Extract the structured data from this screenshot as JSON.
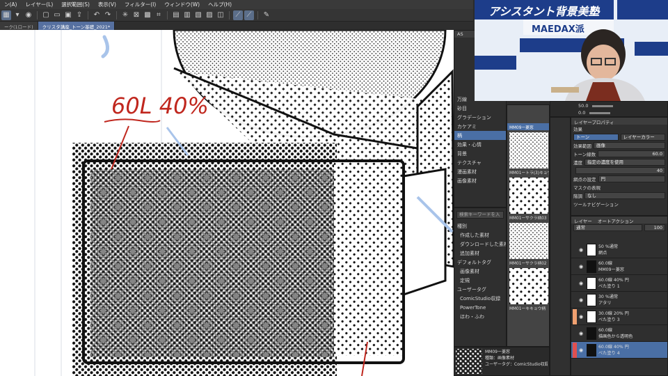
{
  "menu": [
    {
      "label": "ン(A)"
    },
    {
      "label": "レイヤー(L)"
    },
    {
      "label": "選択範囲(S)"
    },
    {
      "label": "表示(V)"
    },
    {
      "label": "フィルター(I)"
    },
    {
      "label": "ウィンドウ(W)"
    },
    {
      "label": "ヘルプ(H)"
    }
  ],
  "tabs": [
    {
      "label": "ーク(1ロード)"
    },
    {
      "label": "クリスタ講座_トーン基礎_2021*"
    }
  ],
  "canvas": {
    "annotation": "60L 40%"
  },
  "material_tree": {
    "header": "AS",
    "items": [
      {
        "label": "万線"
      },
      {
        "label": "砂目"
      },
      {
        "label": "グラデーション"
      },
      {
        "label": "カケアミ"
      },
      {
        "label": "柄"
      },
      {
        "label": "効果・心情"
      },
      {
        "label": "背景"
      },
      {
        "label": "テクスチャ"
      },
      {
        "label": "漫画素材"
      },
      {
        "label": "画像素材"
      }
    ],
    "selected_index": 4
  },
  "material_search": {
    "placeholder": "検索キーワードを入",
    "type_label": "種別",
    "types": [
      {
        "label": "作成した素材"
      },
      {
        "label": "ダウンロードした素材"
      },
      {
        "label": "追加素材"
      }
    ],
    "default_tag_label": "デフォルトタグ",
    "default_tags": [
      {
        "label": "画像素材"
      },
      {
        "label": "定規"
      }
    ],
    "user_tag_label": "ユーザータグ",
    "user_tags": [
      {
        "label": "ComicStudio収録"
      },
      {
        "label": "PowerTone"
      },
      {
        "label": "ほわ・ふわ"
      }
    ]
  },
  "material_thumbs": [
    {
      "label": "MM09ー菱窓"
    },
    {
      "label": "MM01ートラ(3)キョウ柄"
    },
    {
      "label": "MM01ーサクラ柄03"
    },
    {
      "label": "MM01ーサクラ柄02"
    },
    {
      "label": "MM01ーキキョウ柄"
    }
  ],
  "material_detail": {
    "name": "MM09ー菱窓",
    "type": "種類：画像素材",
    "tag": "ユーザータグ：ComicStudio収録"
  },
  "navigator": {
    "zoom": "50.0",
    "rotate": "0.0"
  },
  "tool_property": {
    "title": "レイヤープロパティ",
    "effect_label": "効果",
    "tabs": [
      {
        "label": "トーン"
      },
      {
        "label": "レイヤーカラー"
      }
    ],
    "rows": [
      {
        "label": "効果範囲",
        "value": "画像"
      },
      {
        "label": "トーン線数",
        "value": "60.0"
      },
      {
        "label": "濃度",
        "value": "指定の濃度を使用"
      },
      {
        "label": "",
        "value": "40"
      },
      {
        "label": "網点の設定",
        "value": "円"
      },
      {
        "label": "マスクの表現",
        "value": ""
      },
      {
        "label": "階調",
        "value": "なし"
      },
      {
        "label": "ツールナビゲーション",
        "value": ""
      }
    ]
  },
  "layers": {
    "tabs": [
      {
        "label": "レイヤー"
      },
      {
        "label": "オートアクション"
      }
    ],
    "blend": "通常",
    "opacity": "100",
    "items": [
      {
        "line1": "50 %通常",
        "line2": "網点"
      },
      {
        "line1": "60.0線",
        "line2": "MM09ー菱窓"
      },
      {
        "line1": "60.0線 40% 円",
        "line2": "べた塗り 1"
      },
      {
        "line1": "30 %通常",
        "line2": "アタリ"
      },
      {
        "line1": "30.0線 20% 円",
        "line2": "べた塗り 3"
      },
      {
        "line1": "60.0線",
        "line2": "描画色から透明色"
      },
      {
        "line1": "60.0線 40% 円",
        "line2": "べた塗り 4"
      }
    ],
    "selected_index": 6
  },
  "video": {
    "banner_text": "アシスタント背景美塾",
    "brand": "MAEDAX派"
  },
  "colors": {
    "accent": "#4a6fa5",
    "annotation": "#c0271e",
    "marker_orange": "#f0a070",
    "marker_red": "#e05050"
  }
}
